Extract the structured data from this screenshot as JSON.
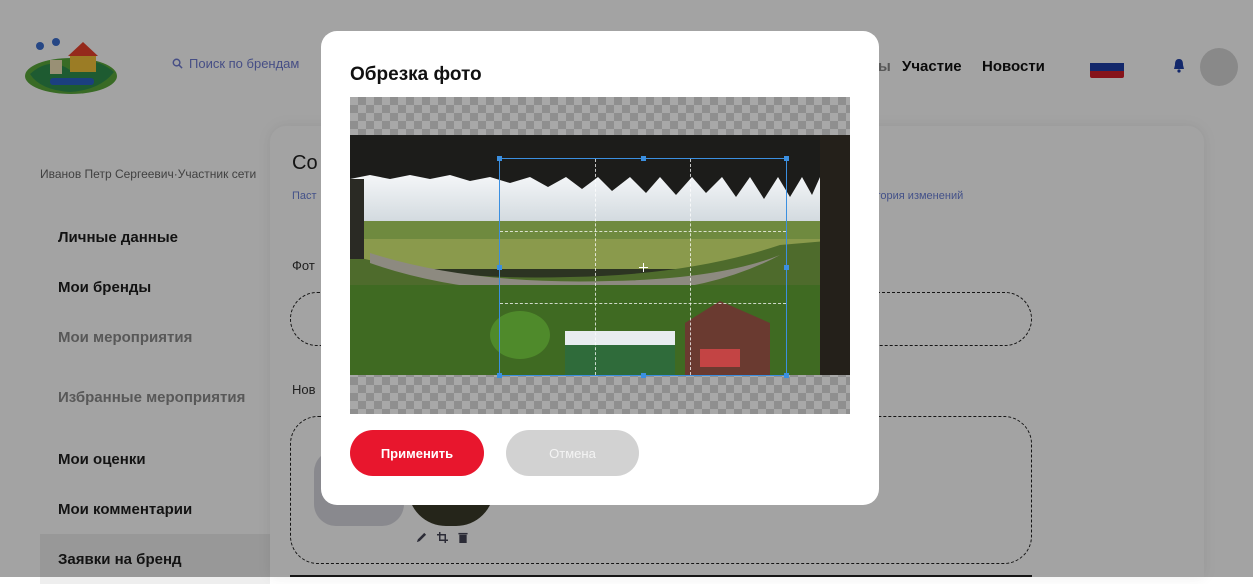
{
  "header": {
    "search_placeholder": "Поиск по брендам",
    "nav_prefix": "ы",
    "nav_participation": "Участие",
    "nav_news": "Новости",
    "flag_colors": [
      "#ffffff",
      "#1f3fa8",
      "#d21f2a"
    ]
  },
  "sidebar": {
    "user_name": "Иванов Петр Сергеевич·Участник сети",
    "items": [
      {
        "label": "Личные данные"
      },
      {
        "label": "Мои бренды"
      },
      {
        "label": "Мои мероприятия"
      },
      {
        "label": "Избранные мероприятия"
      },
      {
        "label": "Мои оценки"
      },
      {
        "label": "Мои комментарии"
      },
      {
        "label": "Заявки на бренд"
      }
    ]
  },
  "main": {
    "title_partial": "Со",
    "tab_left_partial": "Паст",
    "tab_right_partial": "стория изменений",
    "photo_label_partial": "Фот",
    "new_label_partial": "Нов"
  },
  "modal": {
    "title": "Обрезка фото",
    "apply_label": "Применить",
    "cancel_label": "Отмена"
  },
  "colors": {
    "accent_red": "#e8162d",
    "crop_blue": "#3b8fe0",
    "link_blue": "#6a7fd6"
  }
}
